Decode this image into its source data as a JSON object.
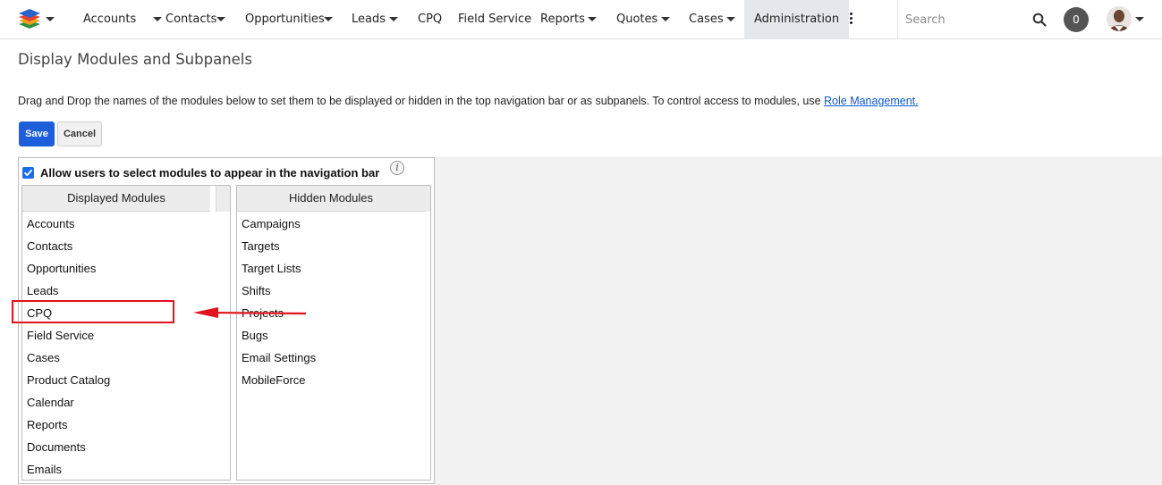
{
  "colors": {
    "primary_button": "#1d5fdb",
    "link": "#0b57d0",
    "annotation": "#e0141e",
    "active_nav_bg": "#e4e8ec"
  },
  "nav": {
    "logo_icon": "stacked-layers-logo",
    "items": [
      {
        "label": "Accounts",
        "has_dropdown": true
      },
      {
        "label": "Contacts",
        "has_dropdown": true
      },
      {
        "label": "Opportunities",
        "has_dropdown": true
      },
      {
        "label": "Leads",
        "has_dropdown": true
      },
      {
        "label": "CPQ",
        "has_dropdown": false
      },
      {
        "label": "Field Service",
        "has_dropdown": false
      },
      {
        "label": "Reports",
        "has_dropdown": true
      },
      {
        "label": "Quotes",
        "has_dropdown": true
      },
      {
        "label": "Cases",
        "has_dropdown": true
      },
      {
        "label": "Administration",
        "has_dropdown": false,
        "active": true
      }
    ],
    "more_icon": "vertical-ellipsis-icon",
    "search_placeholder": "Search",
    "notification_count": "0"
  },
  "page": {
    "title": "Display Modules and Subpanels",
    "intro_text": "Drag and Drop the names of the modules below to set them to be displayed or hidden in the top navigation bar or as subpanels. To control access to modules, use ",
    "intro_link": "Role Management.",
    "save_label": "Save",
    "cancel_label": "Cancel",
    "allow_users_label": "Allow users to select modules to appear in the navigation bar",
    "allow_users_checked": true,
    "info_icon_glyph": "i",
    "displayed_header": "Displayed Modules",
    "hidden_header": "Hidden Modules",
    "displayed_modules": [
      "Accounts",
      "Contacts",
      "Opportunities",
      "Leads",
      "CPQ",
      "Field Service",
      "Cases",
      "Product Catalog",
      "Calendar",
      "Reports",
      "Documents",
      "Emails"
    ],
    "hidden_modules": [
      "Campaigns",
      "Targets",
      "Target Lists",
      "Shifts",
      "Projects",
      "Bugs",
      "Email Settings",
      "MobileForce"
    ],
    "annotation": {
      "highlighted_module": "CPQ",
      "arrow_direction": "left"
    }
  }
}
